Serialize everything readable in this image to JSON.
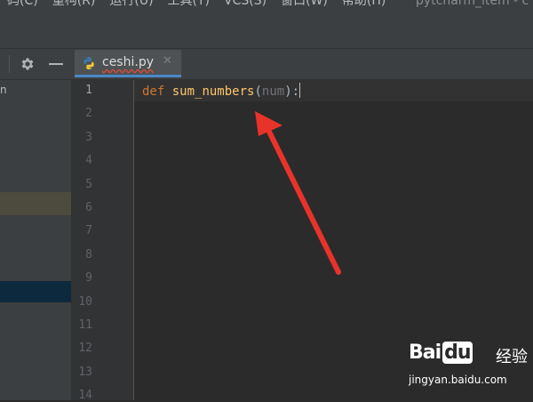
{
  "menu": {
    "items": [
      "码(C)",
      "重构(R)",
      "运行(U)",
      "工具(T)",
      "VCS(S)",
      "窗口(W)",
      "帮助(H)"
    ],
    "window_title": "pytcharm_item - c"
  },
  "toolbar": {
    "settings_icon": "gear-icon",
    "hide_icon": "minus-icon"
  },
  "project": {
    "fragment": "n"
  },
  "tab": {
    "file_name": "ceshi.py",
    "close_label": "✕",
    "icon": "python-file-icon"
  },
  "editor": {
    "lines": [
      "1",
      "2",
      "3",
      "4",
      "5",
      "6",
      "7",
      "8",
      "9",
      "10",
      "11",
      "12",
      "13",
      "14"
    ],
    "code": {
      "keyword": "def",
      "space": " ",
      "func": "sum_numbers",
      "open": "(",
      "param": "num",
      "close": "):"
    }
  },
  "colors": {
    "accent": "#4a88c7",
    "arrow": "#e8332b",
    "keyword": "#cc7832",
    "function": "#ffc66d"
  },
  "watermark": {
    "brand_a": "Bai",
    "brand_b": "du",
    "cn": "经验",
    "url": "jingyan.baidu.com"
  }
}
